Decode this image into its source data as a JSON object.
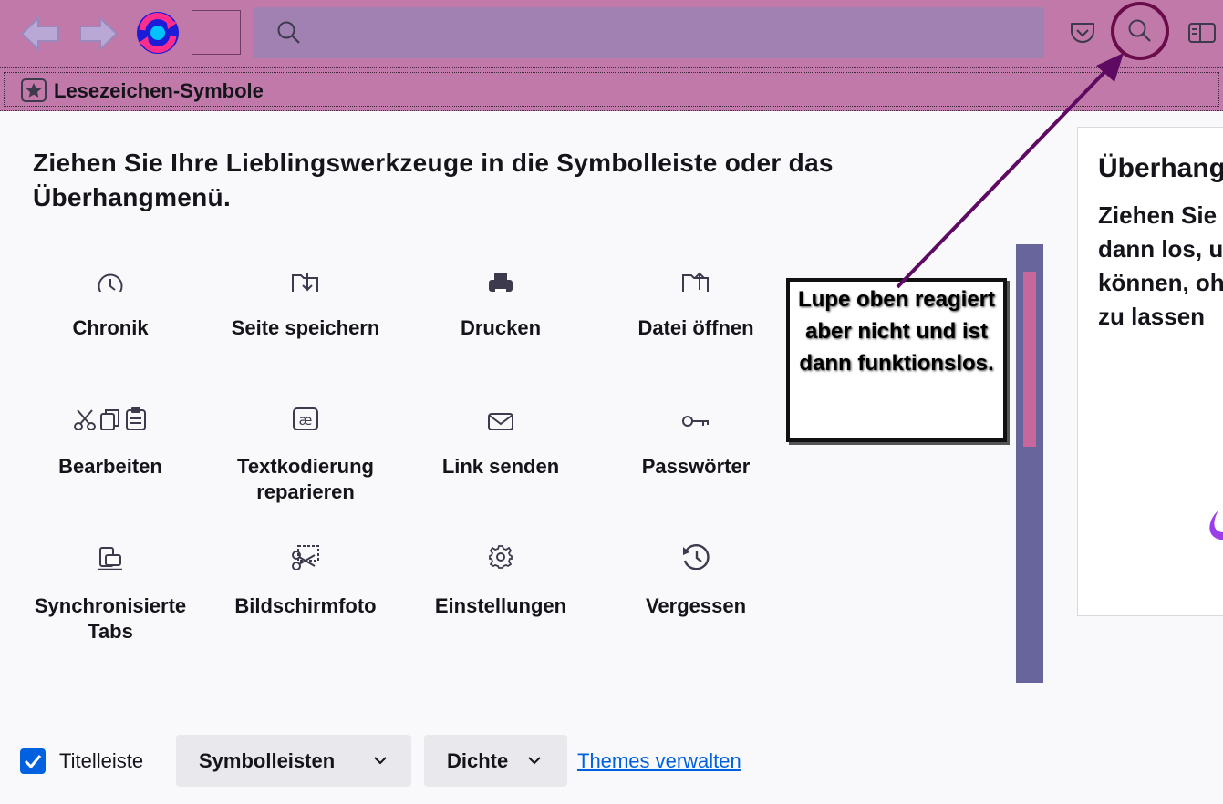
{
  "toolbar": {
    "url_value": "",
    "icons": [
      "back-icon",
      "forward-icon",
      "reload-icon",
      "search-icon",
      "pocket-icon",
      "sidebar-icon"
    ]
  },
  "bookmarks": {
    "label": "Lesezeichen-Symbole"
  },
  "customize": {
    "heading": "Ziehen Sie Ihre Lieblingswerkzeuge in die Symbolleiste oder das Überhangmenü.",
    "items": [
      {
        "label": "Chronik",
        "icon": "clock-icon"
      },
      {
        "label": "Seite speichern",
        "icon": "save-page-icon"
      },
      {
        "label": "Drucken",
        "icon": "printer-icon"
      },
      {
        "label": "Datei öffnen",
        "icon": "open-file-icon"
      },
      {
        "label": "Bearbeiten",
        "icon": "cut-copy-paste-icon"
      },
      {
        "label": "Textkodierung reparieren",
        "icon": "text-encoding-icon"
      },
      {
        "label": "Link senden",
        "icon": "email-icon"
      },
      {
        "label": "Passwörter",
        "icon": "key-icon"
      },
      {
        "label": "Synchronisierte Tabs",
        "icon": "synced-tabs-icon"
      },
      {
        "label": "Bildschirmfoto",
        "icon": "screenshot-icon"
      },
      {
        "label": "Einstellungen",
        "icon": "gear-icon"
      },
      {
        "label": "Vergessen",
        "icon": "history-forget-icon"
      }
    ]
  },
  "annotation": {
    "text": "Lupe oben reagiert aber nicht und ist dann funktionslos."
  },
  "overflow": {
    "title": "Überhangmenü",
    "text": "Ziehen Sie ein Element hierher und\ndann los, um es später erreichen zu\nkönnen, ohne die Symbolleiste\nzu lassen"
  },
  "footer": {
    "titlebar_label": "Titelleiste",
    "titlebar_checked": true,
    "toolbars_label": "Symbolleisten",
    "density_label": "Dichte",
    "themes_link": "Themes verwalten"
  },
  "colors": {
    "toolbar_bg": "#c079a8",
    "urlbar_bg": "#a181b1",
    "highlight_circle": "#6b0c4a",
    "arrow": "#5e0a62",
    "accent": "#0061e0"
  }
}
